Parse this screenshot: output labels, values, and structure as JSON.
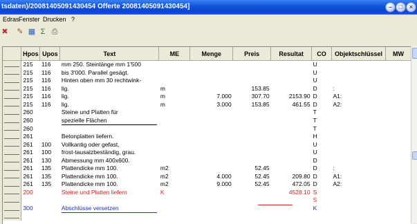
{
  "window": {
    "title": "tsdaten)/20081405091430454 Offerte 20081405091430454]"
  },
  "menu": [
    "Edras",
    "Fenster",
    "Drucken",
    "?"
  ],
  "toolbar": {
    "icons": [
      "delete-icon",
      "edit-icon",
      "table-icon",
      "sum-icon",
      "print-icon"
    ],
    "glyphs": [
      "✖",
      "✎",
      "▦",
      "Σ",
      "⎙"
    ]
  },
  "columns": [
    "Hpos",
    "Upos",
    "Text",
    "ME",
    "Menge",
    "Preis",
    "Resultat",
    "CO",
    "Objektschlüssel",
    "MW"
  ],
  "rows": [
    {
      "hpos": "215",
      "upos": "116",
      "text": "mm 250. Steinlänge mm 1'500",
      "me": "",
      "menge": "",
      "preis": "",
      "resultat": "",
      "co": "U",
      "objekt": ""
    },
    {
      "hpos": "215",
      "upos": "116",
      "text": "bis 3'000. Parallel gesägt.",
      "me": "",
      "menge": "",
      "preis": "",
      "resultat": "",
      "co": "U",
      "objekt": ""
    },
    {
      "hpos": "215",
      "upos": "116",
      "text": "Hinten oben mm 30 rechtwink-",
      "me": "",
      "menge": "",
      "preis": "",
      "resultat": "",
      "co": "U",
      "objekt": ""
    },
    {
      "hpos": "215",
      "upos": "116",
      "text": "lig.",
      "me": "m",
      "menge": "",
      "preis": "153.85",
      "resultat": "",
      "co": "D",
      "objekt": ":"
    },
    {
      "hpos": "215",
      "upos": "116",
      "text": "lig.",
      "me": "m",
      "menge": "7.000",
      "preis": "307.70",
      "resultat": "2153.90",
      "co": "D",
      "objekt": "A1:"
    },
    {
      "hpos": "215",
      "upos": "116",
      "text": "lig.",
      "me": "m",
      "menge": "3.000",
      "preis": "153.85",
      "resultat": "461.55",
      "co": "D",
      "objekt": "A2:"
    },
    {
      "hpos": "260",
      "upos": "",
      "text": "Steine und Platten für",
      "me": "",
      "menge": "",
      "preis": "",
      "resultat": "",
      "co": "T",
      "objekt": ""
    },
    {
      "hpos": "260",
      "upos": "",
      "text": "spezielle Flächen",
      "me": "",
      "menge": "",
      "preis": "",
      "resultat": "",
      "co": "T",
      "objekt": "",
      "ul": "black"
    },
    {
      "hpos": "260",
      "upos": "",
      "text": "",
      "me": "",
      "menge": "",
      "preis": "",
      "resultat": "",
      "co": "T",
      "objekt": ""
    },
    {
      "hpos": "261",
      "upos": "",
      "text": "Betonplatten liefern.",
      "me": "",
      "menge": "",
      "preis": "",
      "resultat": "",
      "co": "H",
      "objekt": ""
    },
    {
      "hpos": "261",
      "upos": "100",
      "text": "Vollkantig oder gefast,",
      "me": "",
      "menge": "",
      "preis": "",
      "resultat": "",
      "co": "U",
      "objekt": ""
    },
    {
      "hpos": "261",
      "upos": "100",
      "text": "frost-tausalzbeständig, grau.",
      "me": "",
      "menge": "",
      "preis": "",
      "resultat": "",
      "co": "U",
      "objekt": ""
    },
    {
      "hpos": "261",
      "upos": "130",
      "text": "Abmessung mm 400x600.",
      "me": "",
      "menge": "",
      "preis": "",
      "resultat": "",
      "co": "D",
      "objekt": ""
    },
    {
      "hpos": "261",
      "upos": "135",
      "text": "Plattendicke mm 100.",
      "me": "m2",
      "menge": "",
      "preis": "52.45",
      "resultat": "",
      "co": "D",
      "objekt": ":"
    },
    {
      "hpos": "261",
      "upos": "135",
      "text": "Plattendicke mm 100.",
      "me": "m2",
      "menge": "4.000",
      "preis": "52.45",
      "resultat": "209.80",
      "co": "D",
      "objekt": "A1:"
    },
    {
      "hpos": "261",
      "upos": "135",
      "text": "Plattendicke mm 100.",
      "me": "m2",
      "menge": "9.000",
      "preis": "52.45",
      "resultat": "472.05",
      "co": "D",
      "objekt": "A2:"
    },
    {
      "hpos": "200",
      "upos": "",
      "text": "Steine und Platten liefern",
      "me": "K",
      "menge": "",
      "preis": "",
      "resultat": "4528.10",
      "co": "S",
      "objekt": "",
      "color": "red"
    },
    {
      "hpos": "",
      "upos": "",
      "text": "",
      "me": "",
      "menge": "",
      "preis": "",
      "resultat": "",
      "co": "S",
      "objekt": "",
      "color": "red"
    },
    {
      "hpos": "300",
      "upos": "",
      "text": "Abschlüsse versetzen",
      "me": "",
      "menge": "",
      "preis": "",
      "resultat": "",
      "co": "K",
      "objekt": "",
      "color": "blue",
      "ul": "blue"
    },
    {
      "hpos": "",
      "upos": "",
      "text": "",
      "me": "",
      "menge": "",
      "preis": "",
      "resultat": "",
      "co": "",
      "objekt": "",
      "color": "blue"
    }
  ],
  "colors": {
    "titlebar": "#0f53d8",
    "red": "#d62020",
    "blue": "#1a2fc8"
  }
}
